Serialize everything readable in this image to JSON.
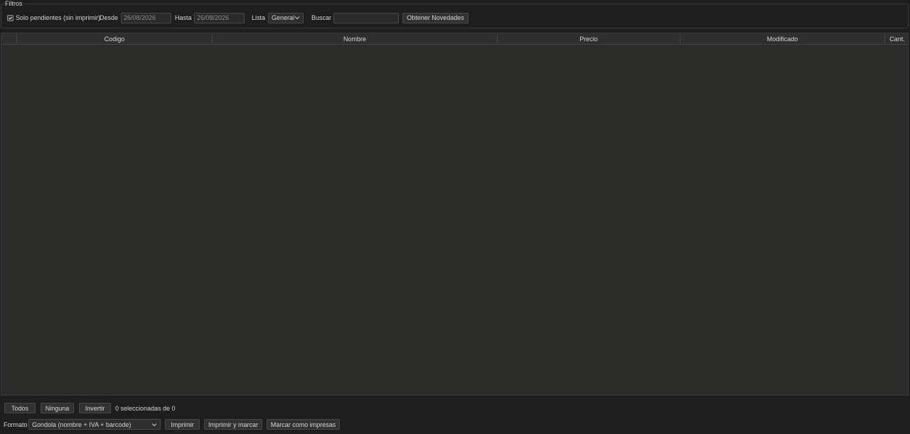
{
  "filters": {
    "legend": "Filtros",
    "pending_only_label": "Solo pendientes (sin imprimir)",
    "pending_only_checked": true,
    "from_label": "Desde",
    "from_value": "26/08/2026",
    "to_label": "Hasta",
    "to_value": "26/08/2026",
    "list_label": "Lista",
    "list_value": "General",
    "search_label": "Buscar",
    "search_value": "",
    "fetch_button": "Obtener Novedades"
  },
  "table": {
    "columns": [
      "",
      "Codigo",
      "Nombre",
      "Precio",
      "Modificado",
      "Cant."
    ],
    "rows": []
  },
  "selection": {
    "all_button": "Todos",
    "none_button": "Ninguna",
    "invert_button": "Invertir",
    "count_text": "0 seleccionadas de 0"
  },
  "print": {
    "format_label": "Formato",
    "format_value": "Gondola (nombre + IVA + barcode)",
    "print_button": "Imprimir",
    "print_mark_button": "Imprimir y marcar",
    "mark_printed_button": "Marcar como impresas"
  }
}
